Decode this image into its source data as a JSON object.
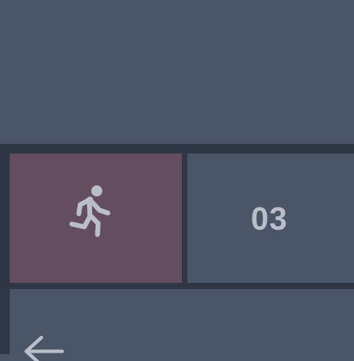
{
  "counter": {
    "value": "03"
  },
  "icons": {
    "activity": "running-person-icon",
    "back": "back-arrow-icon"
  },
  "colors": {
    "background": "#4a5567",
    "frame": "#2f3747",
    "activity_tile": "#634d5e",
    "icon": "#b9bec9"
  }
}
